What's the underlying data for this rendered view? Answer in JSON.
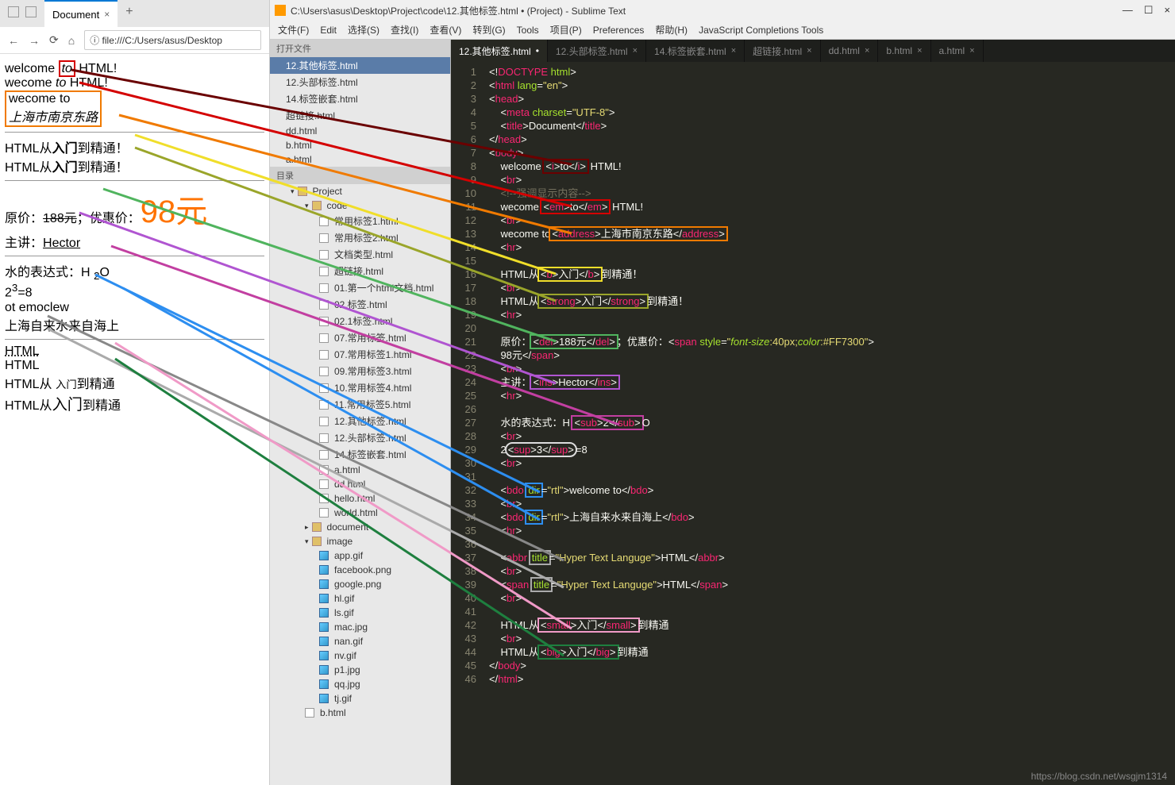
{
  "browser": {
    "tab_title": "Document",
    "url": "file:///C:/Users/asus/Desktop"
  },
  "rendered": {
    "l1_pre": "welcome ",
    "l1_mid": "to",
    "l1_post": " HTML!",
    "l2_pre": "wecome ",
    "l2_mid": "to",
    "l2_post": " HTML!",
    "l3_pre": "wecome to",
    "l3_addr": "上海市南京东路",
    "l4_pre": "HTML从",
    "l4_mid": "入门",
    "l4_post": "到精通！",
    "l5_pre": "HTML从",
    "l5_mid": "入门",
    "l5_post": "到精通！",
    "l6_label": "原价：",
    "l6_del": "188元",
    "l6_sep": "；优惠价：",
    "l6_disc": "98元",
    "l7_label": "主讲：",
    "l7_ins": "Hector",
    "l8": "水的表达式：H ",
    "l8_sub": "2",
    "l8_post": "O",
    "l9_pre": "2",
    "l9_sup": "3",
    "l9_post": "=8",
    "l10": "ot emoclew",
    "l11": "上海自来水来自海上",
    "l12": "HTML",
    "l13": "HTML",
    "l14_pre": "HTML从 ",
    "l14_mid": "入门",
    "l14_post": "到精通",
    "l15_pre": "HTML从",
    "l15_mid": "入门",
    "l15_post": "到精通"
  },
  "editor": {
    "title": "C:\\Users\\asus\\Desktop\\Project\\code\\12.其他标签.html • (Project) - Sublime Text",
    "menus": [
      "文件(F)",
      "Edit",
      "选择(S)",
      "查找(I)",
      "查看(V)",
      "转到(G)",
      "Tools",
      "项目(P)",
      "Preferences",
      "帮助(H)",
      "JavaScript Completions Tools"
    ],
    "open_files_label": "打开文件",
    "open_files": [
      "12.其他标签.html",
      "12.头部标签.html",
      "14.标签嵌套.html",
      "超链接.html",
      "dd.html",
      "b.html",
      "a.html"
    ],
    "folders_label": "目录",
    "tree": {
      "project": "Project",
      "code": "code",
      "code_files": [
        "常用标签1.html",
        "常用标签2.html",
        "文档类型.html",
        "超链接.html",
        "01.第一个html文档.html",
        "02.标签.html",
        "02.1标签.html",
        "07.常用标签.html",
        "07.常用标签1.html",
        "09.常用标签3.html",
        "10.常用标签4.html",
        "11.常用标签5.html",
        "12.其他标签.html",
        "12.头部标签.html",
        "14.标签嵌套.html",
        "a.html",
        "dd.html",
        "hello.html",
        "world.html"
      ],
      "document": "document",
      "image": "image",
      "image_files": [
        "app.gif",
        "facebook.png",
        "google.png",
        "hl.gif",
        "ls.gif",
        "mac.jpg",
        "nan.gif",
        "nv.gif",
        "p1.jpg",
        "qq.jpg",
        "tj.gif"
      ],
      "b": "b.html"
    },
    "tabs": [
      {
        "name": "12.其他标签.html",
        "modified": true,
        "active": true
      },
      {
        "name": "12.头部标签.html",
        "modified": false,
        "active": false
      },
      {
        "name": "14.标签嵌套.html",
        "modified": false,
        "active": false
      },
      {
        "name": "超链接.html",
        "modified": false,
        "active": false
      },
      {
        "name": "dd.html",
        "modified": false,
        "active": false
      },
      {
        "name": "b.html",
        "modified": false,
        "active": false
      },
      {
        "name": "a.html",
        "modified": false,
        "active": false
      }
    ],
    "lines": 46
  },
  "watermark": "https://blog.csdn.net/wsgjm1314"
}
